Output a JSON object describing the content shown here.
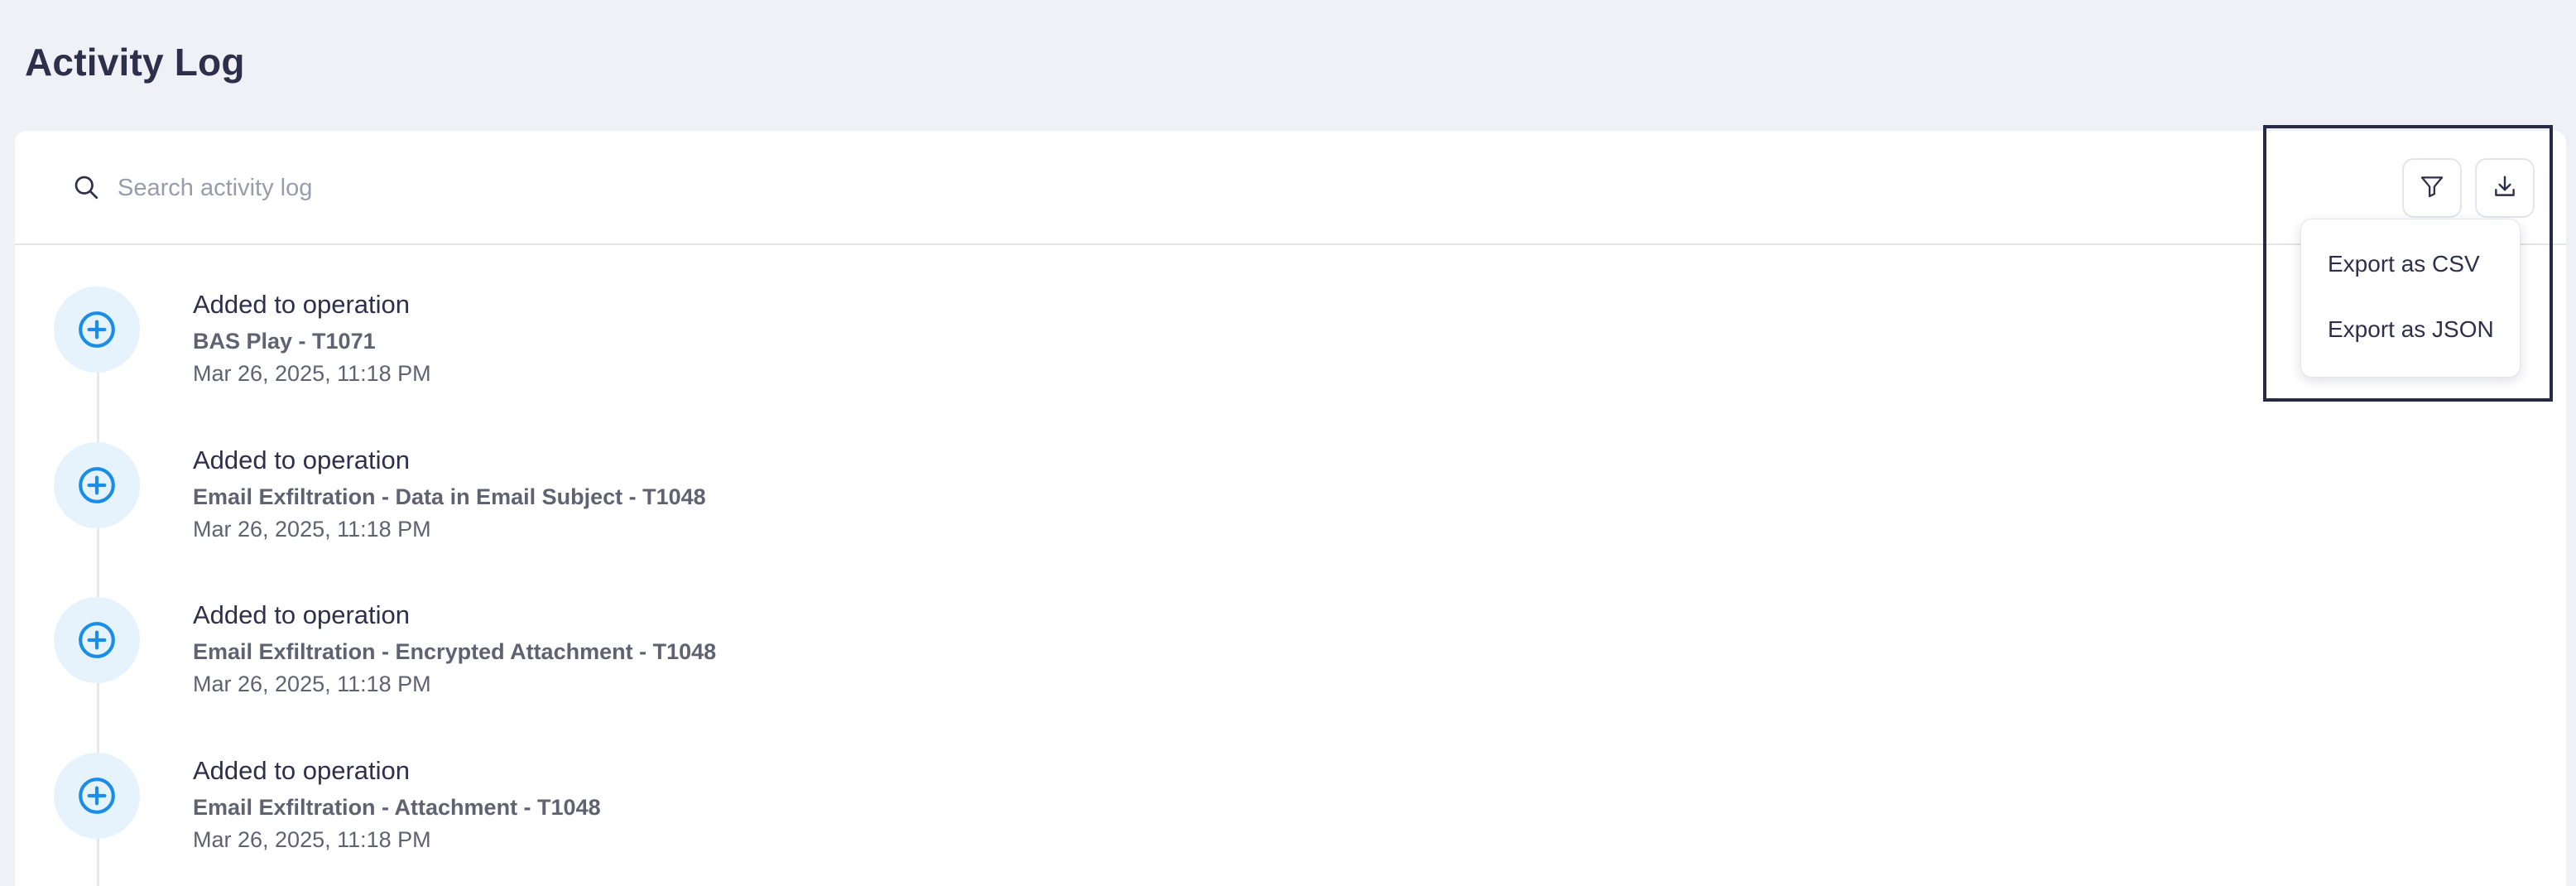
{
  "page": {
    "title": "Activity Log"
  },
  "search": {
    "placeholder": "Search activity log",
    "value": ""
  },
  "toolbar": {
    "filter_icon": "filter-icon",
    "download_icon": "download-icon"
  },
  "export_menu": {
    "items": [
      {
        "label": "Export as CSV"
      },
      {
        "label": "Export as JSON"
      }
    ]
  },
  "activity": {
    "entries": [
      {
        "title": "Added to operation",
        "subtitle": "BAS Play - T1071",
        "timestamp": "Mar 26, 2025, 11:18 PM",
        "icon": "plus-circle-icon"
      },
      {
        "title": "Added to operation",
        "subtitle": "Email Exfiltration - Data in Email Subject - T1048",
        "timestamp": "Mar 26, 2025, 11:18 PM",
        "icon": "plus-circle-icon"
      },
      {
        "title": "Added to operation",
        "subtitle": "Email Exfiltration - Encrypted Attachment - T1048",
        "timestamp": "Mar 26, 2025, 11:18 PM",
        "icon": "plus-circle-icon"
      },
      {
        "title": "Added to operation",
        "subtitle": "Email Exfiltration - Attachment - T1048",
        "timestamp": "Mar 26, 2025, 11:18 PM",
        "icon": "plus-circle-icon"
      }
    ]
  },
  "colors": {
    "accent": "#1a8ee6",
    "icon_bg": "#e6f3fc",
    "page_bg": "#f0f1f6",
    "highlight": "#262a45"
  }
}
